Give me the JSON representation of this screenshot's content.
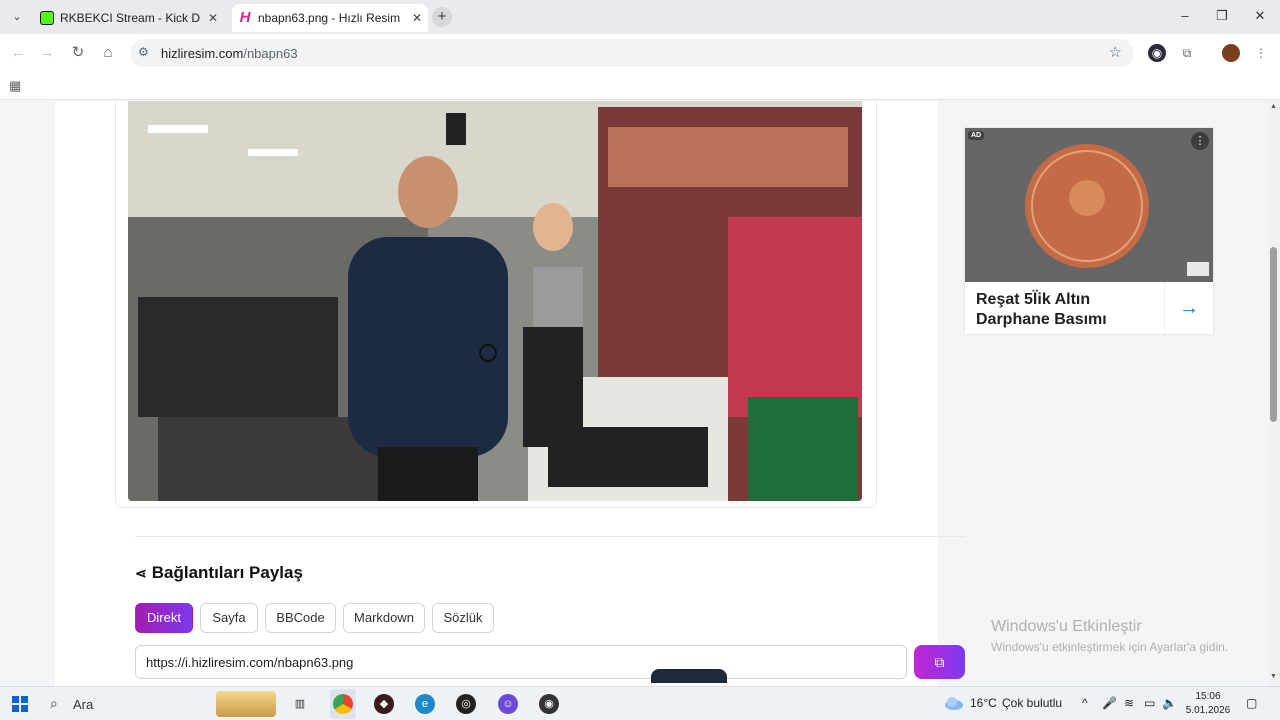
{
  "browser": {
    "tabs": [
      {
        "title": "RKBEKCI Stream - Kick Dashboard",
        "active": false
      },
      {
        "title": "nbapn63.png - Hızlı Resim",
        "active": true
      }
    ],
    "url_host": "hizliresim.com",
    "url_path": "/nbapn63"
  },
  "share": {
    "title": "Bağlantıları Paylaş",
    "tabs": [
      "Direkt",
      "Sayfa",
      "BBCode",
      "Markdown",
      "Sözlük"
    ],
    "active_tab": "Direkt",
    "link_value": "https://i.hizliresim.com/nbapn63.png"
  },
  "ad": {
    "badge": "AD",
    "title": "Reşat 5l̈ik Altın Darphane Basımı"
  },
  "watermark": {
    "line1": "Windows'u Etkinleştir",
    "line2": "Windows'u etkinleştirmek için Ayarlar'a gidin."
  },
  "taskbar": {
    "search_text": "Ara",
    "temperature": "16°C",
    "weather": "Çok bulutlu",
    "time": "15:06",
    "date": "5.01.2026"
  },
  "colors": {
    "accent_gradient_start": "#a21caf",
    "accent_gradient_end": "#7c3aed",
    "kick_green": "#53fc18"
  }
}
